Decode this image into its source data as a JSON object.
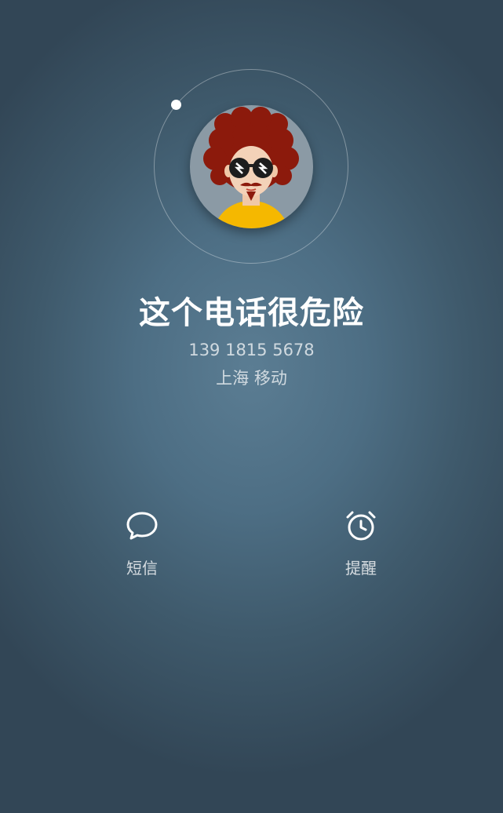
{
  "caller": {
    "name": "这个电话很危险",
    "number": "139 1815 5678",
    "location": "上海 移动"
  },
  "actions": [
    {
      "label": "短信",
      "icon": "message-bubble-icon"
    },
    {
      "label": "提醒",
      "icon": "alarm-clock-icon"
    }
  ],
  "colors": {
    "background_center": "#5b7d93",
    "background_edge": "#324656",
    "text_primary": "#ffffff"
  }
}
